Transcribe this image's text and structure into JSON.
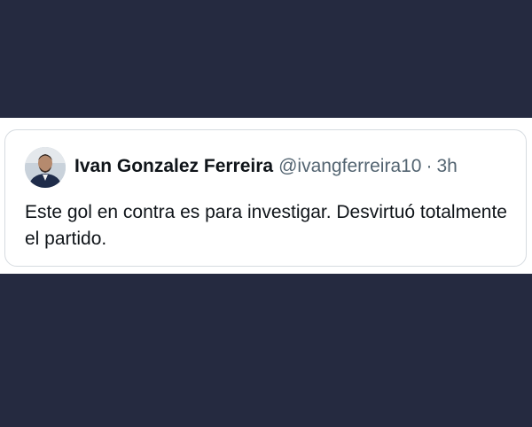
{
  "tweet": {
    "author_name": "Ivan Gonzalez Ferreira",
    "author_handle": "@ivangferreira10",
    "separator": "·",
    "timestamp": "3h",
    "text": "Este gol en contra es para investigar. Desvirtuó totalmente el partido.",
    "avatar_icon": "profile-photo"
  },
  "colors": {
    "background": "#252a40",
    "card": "#ffffff",
    "border": "#d6dbe0",
    "text_primary": "#0f1419",
    "text_secondary": "#536471"
  }
}
